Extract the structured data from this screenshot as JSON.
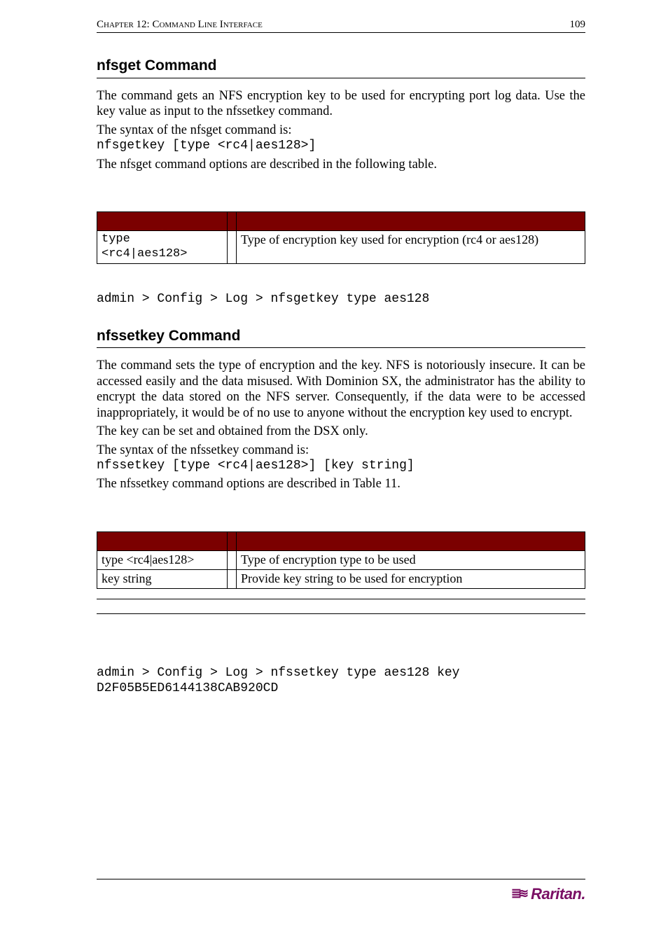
{
  "header": {
    "chapter": "Chapter 12: Command Line Interface",
    "page_number": "109"
  },
  "nfsget": {
    "heading": "nfsget Command",
    "para1_pre": "The ",
    "para1_post": " command gets an NFS encryption key to be used for encrypting port log data. Use the key value as input to the nfssetkey command.",
    "syntax_intro": "The syntax of the nfsget command is:",
    "syntax_code": "nfsgetkey [type <rc4|aes128>]",
    "options_intro": "The nfsget command options are described in the following table.",
    "table": {
      "row1": {
        "option": "type <rc4|aes128>",
        "desc": "Type of encryption key used for encryption (rc4 or aes128)"
      }
    },
    "example": "admin > Config > Log > nfsgetkey type aes128"
  },
  "nfssetkey": {
    "heading": "nfssetkey Command",
    "para1_pre": "The ",
    "para1_post": " command sets the type of encryption and the key. NFS is notoriously insecure. It can be accessed easily and the data misused. With Dominion SX, the administrator has the ability to encrypt the data stored on the NFS server. Consequently, if the data were to be accessed inappropriately, it would be of no use to anyone without the encryption key used to encrypt.",
    "para2": "The key can be set and obtained from the DSX only.",
    "syntax_intro": "The syntax of the nfssetkey command is:",
    "syntax_code": "nfssetkey [type <rc4|aes128>] [key string]",
    "options_intro": "The nfssetkey command options are described in Table 11.",
    "table": {
      "row1": {
        "option": "type <rc4|aes128>",
        "desc": "Type of encryption type to be used"
      },
      "row2": {
        "option": "key string",
        "desc": "Provide key string to be used for encryption"
      }
    },
    "example": "admin > Config > Log > nfssetkey type aes128 key D2F05B5ED6144138CAB920CD"
  },
  "footer": {
    "brand": "Raritan."
  }
}
